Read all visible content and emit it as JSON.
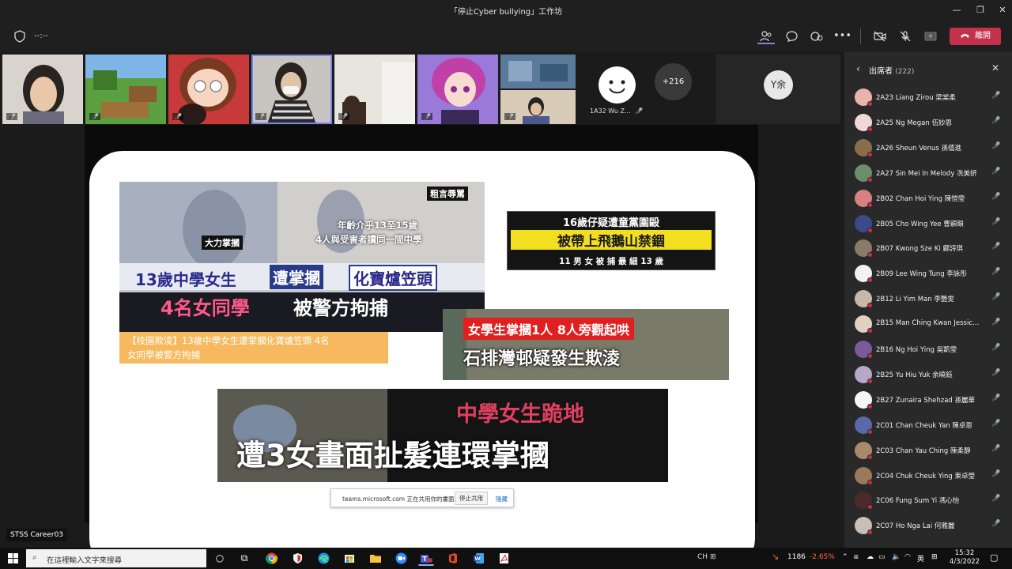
{
  "window": {
    "title": "「停止Cyber bullying」工作坊",
    "minimize_glyph": "—",
    "maximize_glyph": "❐",
    "close_glyph": "✕"
  },
  "toolbar": {
    "timer": "--:--",
    "leave_label": "離開",
    "icons": [
      "shield-icon",
      "participants-icon",
      "chat-icon",
      "reactions-icon",
      "more-icon",
      "camera-off-icon",
      "mic-off-icon",
      "share-icon",
      "phone-icon"
    ]
  },
  "stage": {
    "tiles": [
      {
        "name": "participant-tile-1",
        "muted": "🎤̸"
      },
      {
        "name": "participant-tile-2",
        "muted": "🎤̸"
      },
      {
        "name": "participant-tile-3",
        "muted": "🎤̸"
      },
      {
        "name": "participant-tile-4",
        "muted": "🎤̸"
      },
      {
        "name": "participant-tile-5",
        "muted": "🎤̸"
      },
      {
        "name": "participant-tile-6",
        "muted": "🎤̸"
      },
      {
        "name": "participant-tile-7",
        "muted": "🎤̸"
      }
    ],
    "avatar_tile_label": "1A32 Wu Z...",
    "overflow_count": "+216",
    "initials_tile": "Y余",
    "presenter_name": "STSS Career03"
  },
  "slide": {
    "news1": {
      "tag_top": "粗言辱罵",
      "tag_left": "大力掌摑",
      "age_line1": "年齡介乎13至15歲",
      "age_line2": "4人與受害者讀同一間中學",
      "headline_a": "13歲中學女生",
      "headline_b": "遭掌摑",
      "headline_c": "化寶爐笠頭",
      "headline_d": "4名女同學",
      "headline_e": "被警方拘捕",
      "caption_line1": "【校園欺淩】13歲中學女生遭掌摑化寶爐笠頭 4名",
      "caption_line2": "女同學被警方拘捕"
    },
    "news2": {
      "line1": "16歲仔疑遭童黨圍毆",
      "line2": "被帶上飛鵝山禁錮",
      "line3": "11 男 女 被 捕    最 細 13 歲"
    },
    "news3": {
      "line1": "女學生掌摑1人  8人旁觀起哄",
      "line2": "石排灣邨疑發生欺淩"
    },
    "news4": {
      "line1": "中學女生跪地",
      "line2": "遭3女畫面扯髮連環掌摑"
    }
  },
  "share_bar": {
    "message": "teams.microsoft.com 正在共用你的畫面。",
    "stop_label": "停止共用",
    "hide_label": "隱藏"
  },
  "panel": {
    "title": "出席者",
    "count": "(222)",
    "participants": [
      {
        "name": "2A23 Liang Zirou 梁棠柔",
        "avatar_color": "#e8b4a8"
      },
      {
        "name": "2A25 Ng Megan 伍妙恩",
        "avatar_color": "#f0d8d8"
      },
      {
        "name": "2A26 Sheun Venus 孫僖進",
        "avatar_color": "#8a6d4b"
      },
      {
        "name": "2A27 Sin Mei In Melody 冼美妍",
        "avatar_color": "#6b8f6b"
      },
      {
        "name": "2B02 Chan Hoi Ying 陳愷瑩",
        "avatar_color": "#d98080"
      },
      {
        "name": "2B05 Cho Wing Yee 曹穎頤",
        "avatar_color": "#3b4a8a"
      },
      {
        "name": "2B07 Kwong Sze Ki 鄺詩琪",
        "avatar_color": "#8a7a6a"
      },
      {
        "name": "2B09 Lee Wing Tung 李詠彤",
        "avatar_color": "#f2f2f2"
      },
      {
        "name": "2B12 Li Yim Man 李艷雯",
        "avatar_color": "#c8b8a8"
      },
      {
        "name": "2B15 Man Ching Kwan Jessica ...",
        "avatar_color": "#e0d0c0"
      },
      {
        "name": "2B16 Ng Hoi Ying 吳凱瑩",
        "avatar_color": "#7a5a9a"
      },
      {
        "name": "2B25 Yu Hiu Yuk 余曉鈺",
        "avatar_color": "#b8a8c8"
      },
      {
        "name": "2B27 Zunaira Shehzad 孫麗華",
        "avatar_color": "#f5f5f5"
      },
      {
        "name": "2C01 Chan Cheuk Yan 陳卓恩",
        "avatar_color": "#5a6aa8"
      },
      {
        "name": "2C03 Chan Yau Ching 陳柔靜",
        "avatar_color": "#a88a6a"
      },
      {
        "name": "2C04 Chuk Cheuk Ying 束卓瑩",
        "avatar_color": "#9a7a5a"
      },
      {
        "name": "2C06 Fung Sum Yi 馮心怡",
        "avatar_color": "#4a2a2a"
      },
      {
        "name": "2C07 Ho Nga Lai 何雅麗",
        "avatar_color": "#c8c0b8"
      }
    ]
  },
  "taskbar": {
    "search_placeholder": "在這裡輸入文字來搜尋",
    "stock_value": "1186",
    "stock_change": "-2.65%",
    "ime_lang": "英",
    "ime_mode": "CH",
    "time": "15:32",
    "date": "4/3/2022"
  },
  "colors": {
    "leave_red": "#c4314b",
    "accent": "#7b83eb",
    "stock_down": "#ff6a3d"
  }
}
